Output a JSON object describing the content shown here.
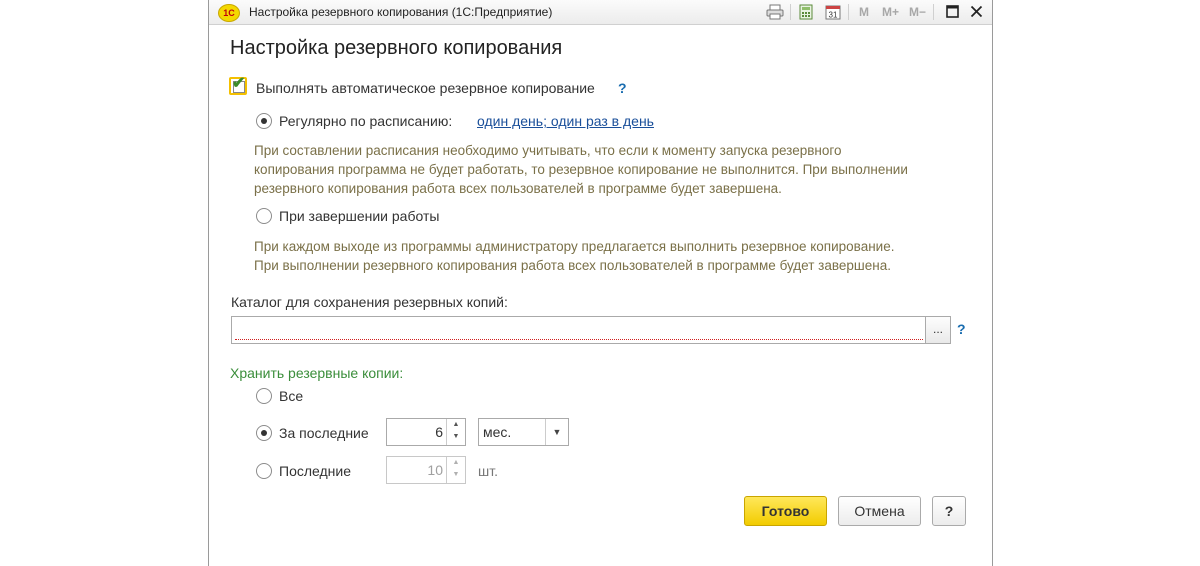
{
  "window": {
    "logo": "1С",
    "title": "Настройка резервного копирования  (1С:Предприятие)",
    "toolbar": {
      "m": "M",
      "m_plus": "M+",
      "m_minus": "M−",
      "calendar_day": "31"
    }
  },
  "form": {
    "heading": "Настройка резервного копирования",
    "auto_backup": {
      "label": "Выполнять автоматическое резервное копирование",
      "checked": true,
      "help": "?"
    },
    "schedule_option": {
      "label": "Регулярно по расписанию:",
      "link": "один день; один раз в день",
      "selected": true
    },
    "schedule_note": [
      "При составлении расписания необходимо учитывать, что если к моменту запуска резервного",
      "копирования программа не будет работать, то резервное копирование не выполнится. При выполнении",
      "резервного копирования работа всех пользователей в программе будет завершена."
    ],
    "exit_option": {
      "label": "При завершении работы",
      "selected": false
    },
    "exit_note": [
      "При каждом выходе из программы администратору предлагается выполнить резервное копирование.",
      "При выполнении резервного копирования работа всех пользователей в программе будет завершена."
    ],
    "directory": {
      "label": "Каталог для сохранения резервных копий:",
      "value": "",
      "browse": "...",
      "help": "?"
    },
    "keep": {
      "label": "Хранить резервные копии:",
      "all": {
        "label": "Все",
        "selected": false
      },
      "for_last": {
        "label": "За последние",
        "value": "6",
        "unit": "мес.",
        "selected": true
      },
      "last_n": {
        "label": "Последние",
        "value": "10",
        "unit": "шт.",
        "selected": false
      }
    },
    "buttons": {
      "ok": "Готово",
      "cancel": "Отмена",
      "help": "?"
    }
  }
}
